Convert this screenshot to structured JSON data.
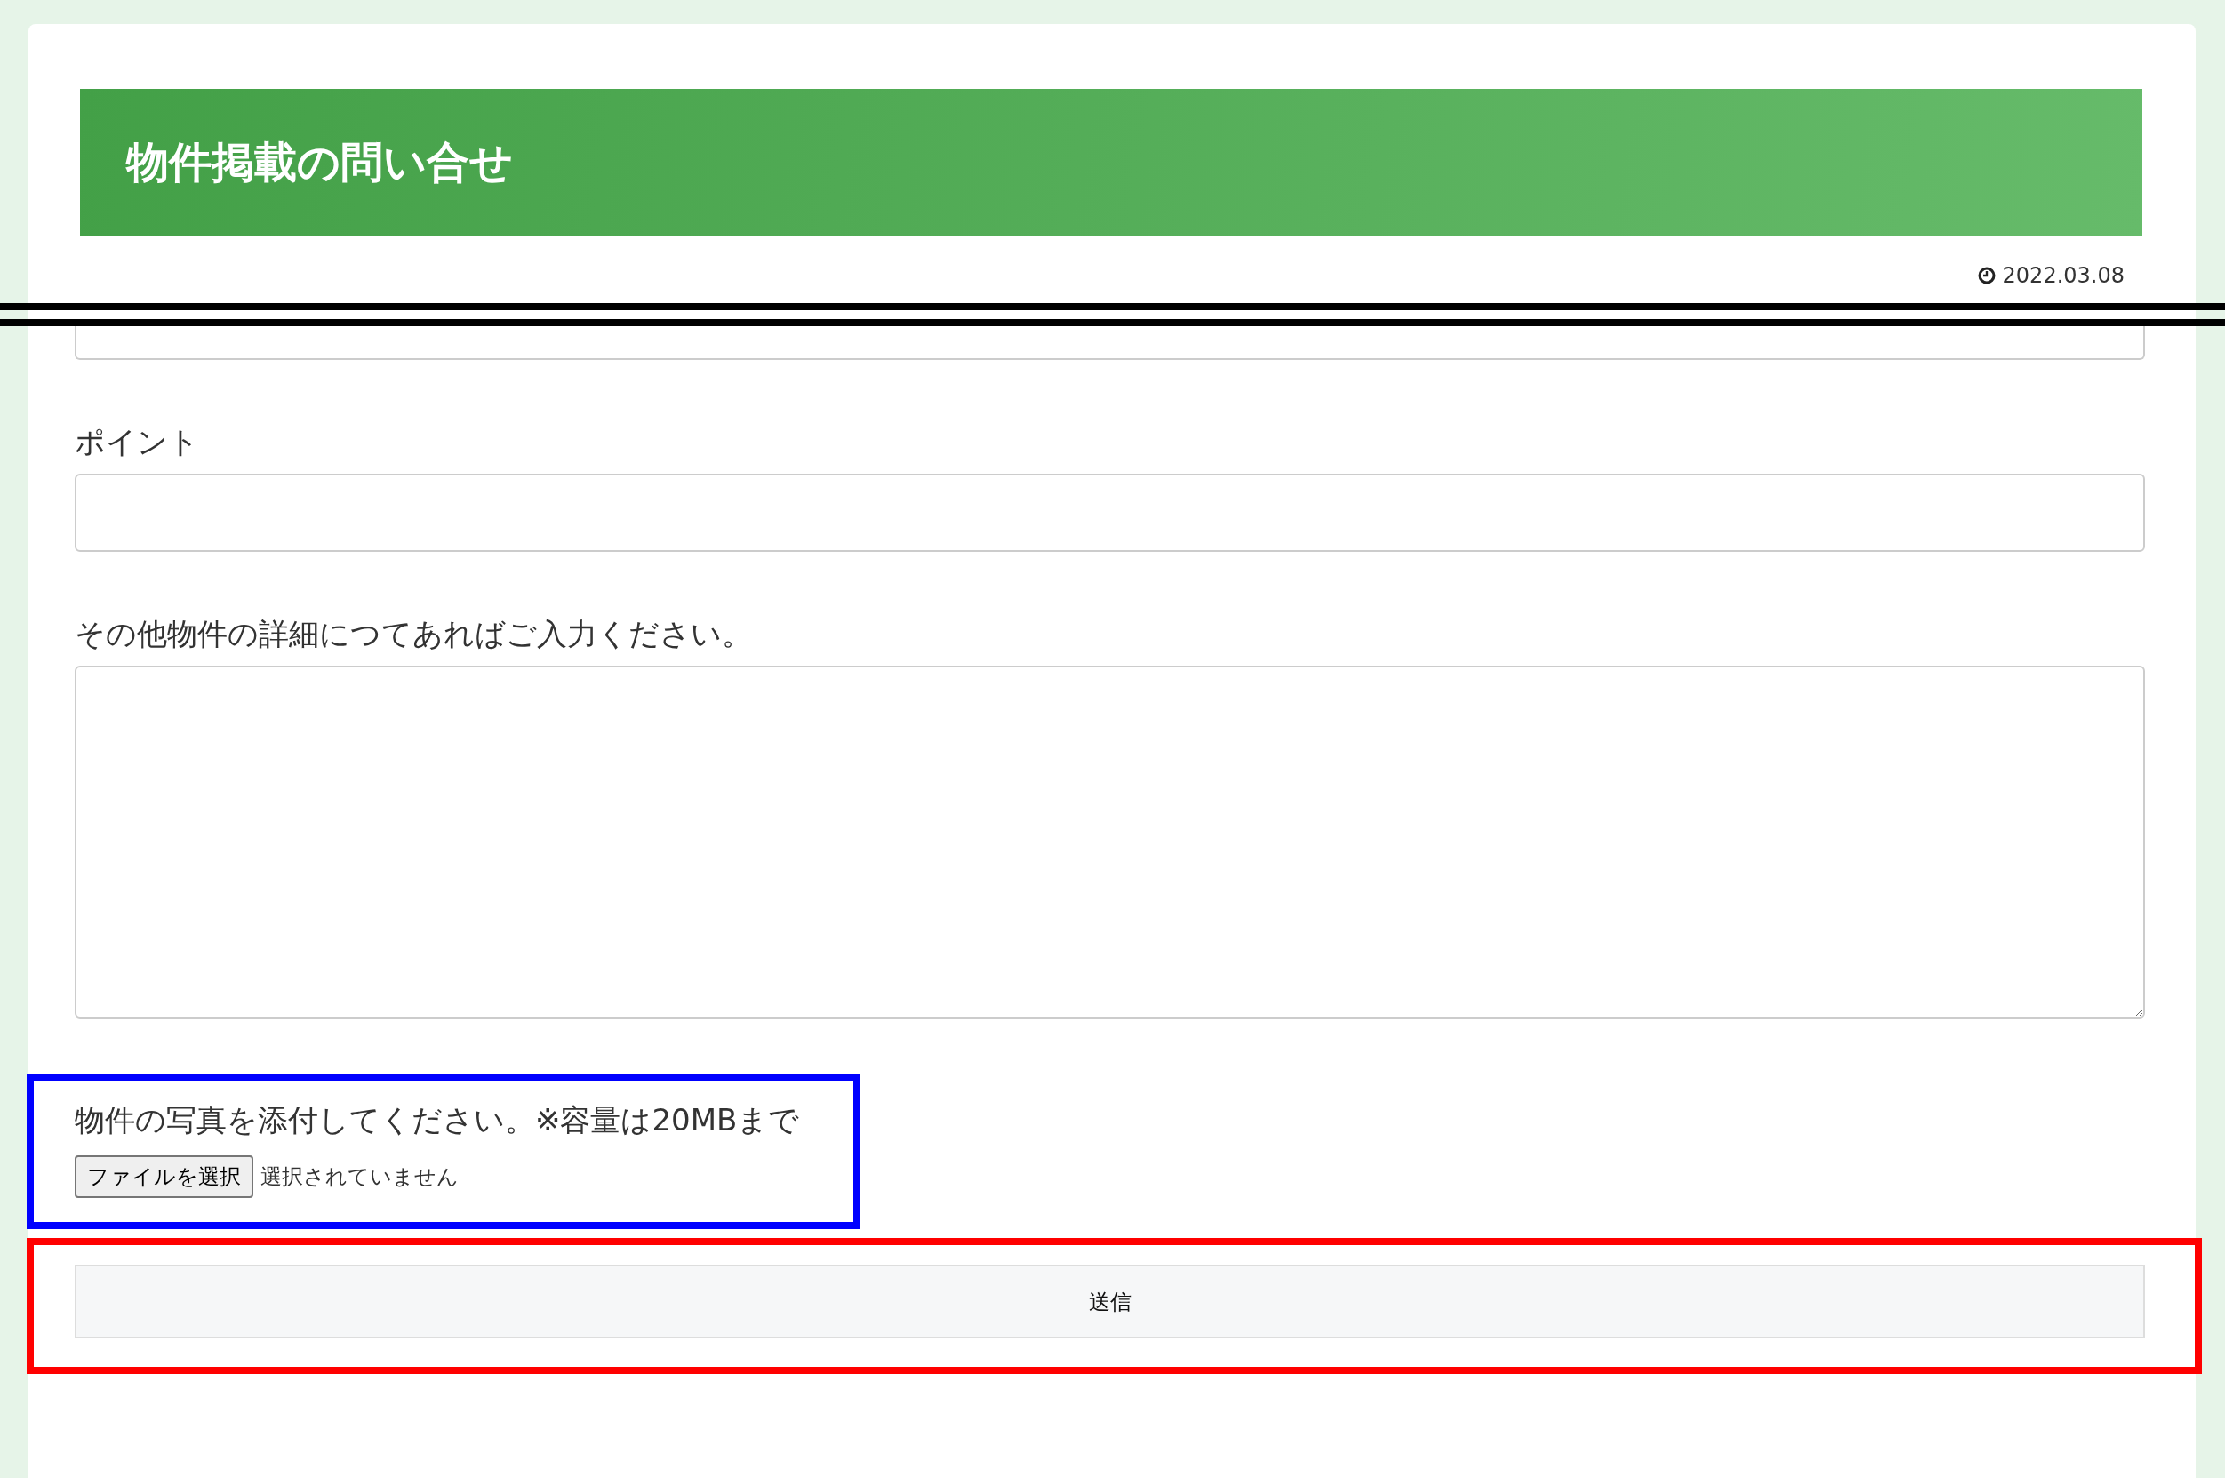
{
  "header": {
    "title": "物件掲載の問い合せ",
    "date": "2022.03.08"
  },
  "fields": [
    {
      "kind": "cut-input"
    },
    {
      "kind": "input",
      "label": "ポイント"
    },
    {
      "kind": "textarea",
      "label": "その他物件の詳細につてあればご入力ください。"
    }
  ],
  "upload": {
    "label": "物件の写真を添付してください。※容量は20MBまで",
    "button": "ファイルを選択",
    "status": "選択されていません"
  },
  "submit": {
    "label": "送信"
  }
}
